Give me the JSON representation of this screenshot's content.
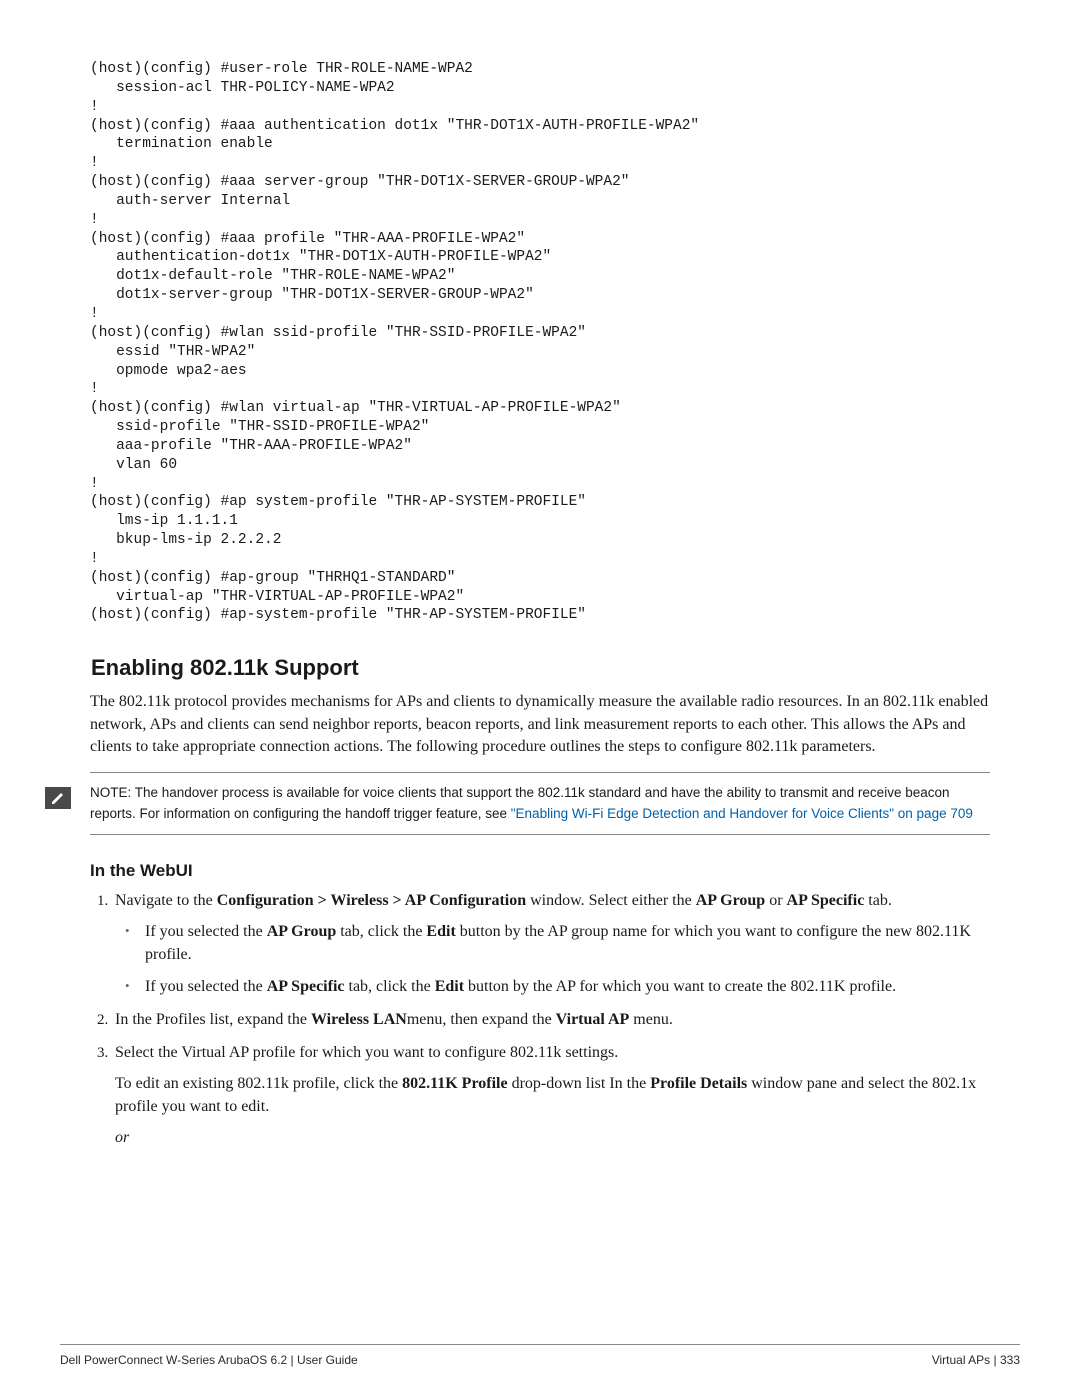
{
  "code": "(host)(config) #user-role THR-ROLE-NAME-WPA2\n   session-acl THR-POLICY-NAME-WPA2\n!\n(host)(config) #aaa authentication dot1x \"THR-DOT1X-AUTH-PROFILE-WPA2\"\n   termination enable\n!\n(host)(config) #aaa server-group \"THR-DOT1X-SERVER-GROUP-WPA2\"\n   auth-server Internal\n!\n(host)(config) #aaa profile \"THR-AAA-PROFILE-WPA2\"\n   authentication-dot1x \"THR-DOT1X-AUTH-PROFILE-WPA2\"\n   dot1x-default-role \"THR-ROLE-NAME-WPA2\"\n   dot1x-server-group \"THR-DOT1X-SERVER-GROUP-WPA2\"\n!\n(host)(config) #wlan ssid-profile \"THR-SSID-PROFILE-WPA2\"\n   essid \"THR-WPA2\"\n   opmode wpa2-aes\n!\n(host)(config) #wlan virtual-ap \"THR-VIRTUAL-AP-PROFILE-WPA2\"\n   ssid-profile \"THR-SSID-PROFILE-WPA2\"\n   aaa-profile \"THR-AAA-PROFILE-WPA2\"\n   vlan 60\n!\n(host)(config) #ap system-profile \"THR-AP-SYSTEM-PROFILE\"\n   lms-ip 1.1.1.1\n   bkup-lms-ip 2.2.2.2\n!\n(host)(config) #ap-group \"THRHQ1-STANDARD\"\n   virtual-ap \"THR-VIRTUAL-AP-PROFILE-WPA2\"\n(host)(config) #ap-system-profile \"THR-AP-SYSTEM-PROFILE\"",
  "heading1": "Enabling 802.11k Support",
  "para1": "The 802.11k protocol provides mechanisms for APs and clients to dynamically measure the available radio resources. In an 802.11k enabled network, APs and clients can send neighbor reports, beacon reports, and link measurement reports to each other. This allows the APs and clients to take appropriate connection actions. The following procedure outlines the steps to configure 802.11k parameters.",
  "note": {
    "lead": "NOTE: The handover process is available for voice clients that support the 802.11k standard and have the ability to transmit and receive beacon reports. For information on configuring the handoff trigger feature, see ",
    "link": "\"Enabling Wi-Fi Edge Detection and Handover for Voice Clients\" on page 709"
  },
  "heading2": "In the WebUI",
  "steps": {
    "s1": {
      "pre": "Navigate to the ",
      "b1": "Configuration > Wireless > AP Configuration",
      "mid1": " window. Select either the ",
      "b2": "AP Group",
      "mid2": " or ",
      "b3": "AP Specific",
      "post": " tab.",
      "bullet1": {
        "pre": "If you selected the ",
        "b1": "AP Group",
        "mid1": " tab, click the ",
        "b2": "Edit",
        "post": " button by the AP group name for which you want to configure the new 802.11K profile."
      },
      "bullet2": {
        "pre": "If you selected the ",
        "b1": "AP Specific",
        "mid1": " tab, click the ",
        "b2": "Edit",
        "post": " button by the AP for which you want to create the 802.11K profile."
      }
    },
    "s2": {
      "pre": "In the Profiles list, expand the ",
      "b1": "Wireless LAN",
      "mid1": "menu, then expand the ",
      "b2": "Virtual AP",
      "post": " menu."
    },
    "s3": {
      "line1": "Select the Virtual AP profile for which you want to configure 802.11k settings.",
      "line2pre": "To edit an existing 802.11k profile, click the ",
      "line2b1": "802.11K Profile",
      "line2mid": " drop-down list In the ",
      "line2b2": "Profile Details",
      "line2post": " window pane and select the 802.1x profile you want to edit.",
      "or": "or"
    }
  },
  "footer": {
    "left": "Dell PowerConnect W-Series ArubaOS 6.2 | User Guide",
    "right": "Virtual APs | 333"
  }
}
